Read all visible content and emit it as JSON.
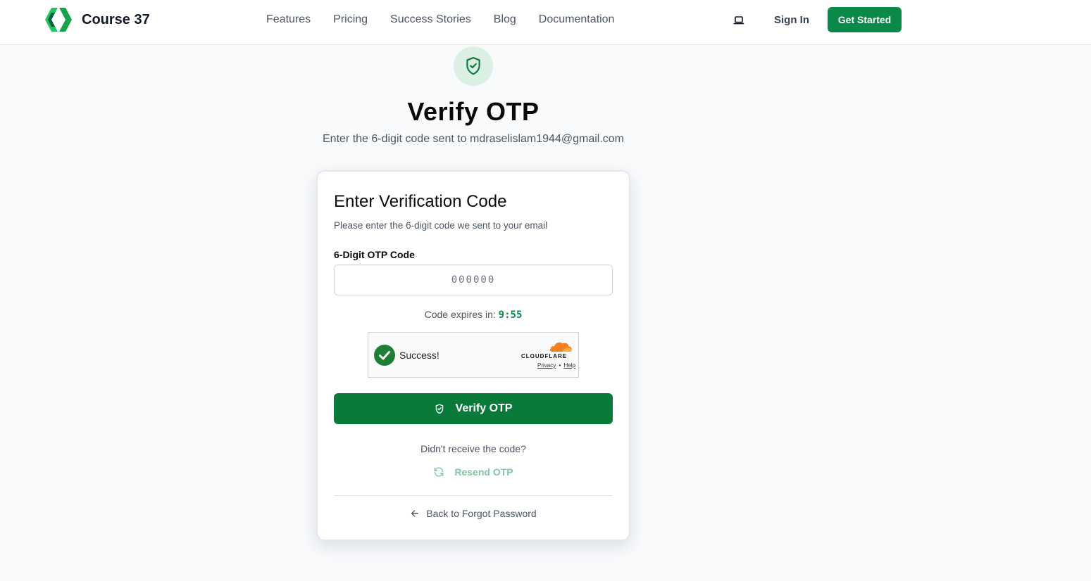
{
  "header": {
    "brand": "Course 37",
    "nav": [
      "Features",
      "Pricing",
      "Success Stories",
      "Blog",
      "Documentation"
    ],
    "sign_in": "Sign In",
    "get_started": "Get Started"
  },
  "hero": {
    "title": "Verify OTP",
    "subtitle": "Enter the 6-digit code sent to mdraselislam1944@gmail.com"
  },
  "card": {
    "title": "Enter Verification Code",
    "description": "Please enter the 6-digit code we sent to your email",
    "otp_label": "6-Digit OTP Code",
    "otp_placeholder": "000000",
    "otp_value": "",
    "expires_label": "Code expires in: ",
    "expires_timer": "9:55",
    "turnstile": {
      "status": "Success!",
      "brand": "CLOUDFLARE",
      "privacy": "Privacy",
      "separator": "•",
      "help": "Help"
    },
    "verify_button": "Verify OTP",
    "didnt_receive": "Didn't receive the code?",
    "resend": "Resend OTP",
    "back_link": "Back to Forgot Password"
  },
  "colors": {
    "brand_green": "#0a8a4a",
    "button_green": "#0a7a3b",
    "resend_green": "#7fc8a0",
    "cloudflare_orange": "#f48120"
  },
  "icons": {
    "logo": "chevrons-logo-icon",
    "laptop": "laptop-icon",
    "hero": "shield-check-icon",
    "verify": "shield-check-icon",
    "resend": "refresh-icon",
    "back": "arrow-left-icon",
    "turnstile": "check-circle-icon"
  }
}
